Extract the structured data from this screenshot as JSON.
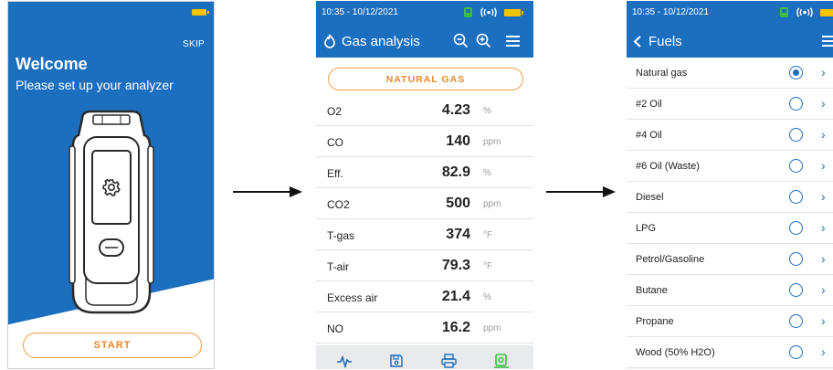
{
  "welcome": {
    "skip": "SKIP",
    "title": "Welcome",
    "subtitle": "Please set up your analyzer",
    "start": "START"
  },
  "gas_analysis": {
    "status_time": "10:35 - 10/12/2021",
    "title": "Gas analysis",
    "fuel_button": "NATURAL GAS",
    "measurements": [
      {
        "label": "O2",
        "value": "4.23",
        "unit": "%"
      },
      {
        "label": "CO",
        "value": "140",
        "unit": "ppm"
      },
      {
        "label": "Eff.",
        "value": "82.9",
        "unit": "%"
      },
      {
        "label": "CO2",
        "value": "500",
        "unit": "ppm"
      },
      {
        "label": "T-gas",
        "value": "374",
        "unit": "°F"
      },
      {
        "label": "T-air",
        "value": "79.3",
        "unit": "°F"
      },
      {
        "label": "Excess air",
        "value": "21.4",
        "unit": "%"
      },
      {
        "label": "NO",
        "value": "16.2",
        "unit": "ppm"
      }
    ]
  },
  "fuels": {
    "status_time": "10:35 - 10/12/2021",
    "title": "Fuels",
    "items": [
      {
        "label": "Natural gas",
        "selected": true
      },
      {
        "label": "#2 Oil",
        "selected": false
      },
      {
        "label": "#4 Oil",
        "selected": false
      },
      {
        "label": "#6 Oil (Waste)",
        "selected": false
      },
      {
        "label": "Diesel",
        "selected": false
      },
      {
        "label": "LPG",
        "selected": false
      },
      {
        "label": "Petrol/Gasoline",
        "selected": false
      },
      {
        "label": "Butane",
        "selected": false
      },
      {
        "label": "Propane",
        "selected": false
      },
      {
        "label": "Wood (50% H2O)",
        "selected": false
      }
    ]
  },
  "colors": {
    "header_blue": "#1c6fbf",
    "accent_orange": "#e8892a",
    "battery_yellow": "#f5c400",
    "pump_green": "#3cbf3c"
  }
}
